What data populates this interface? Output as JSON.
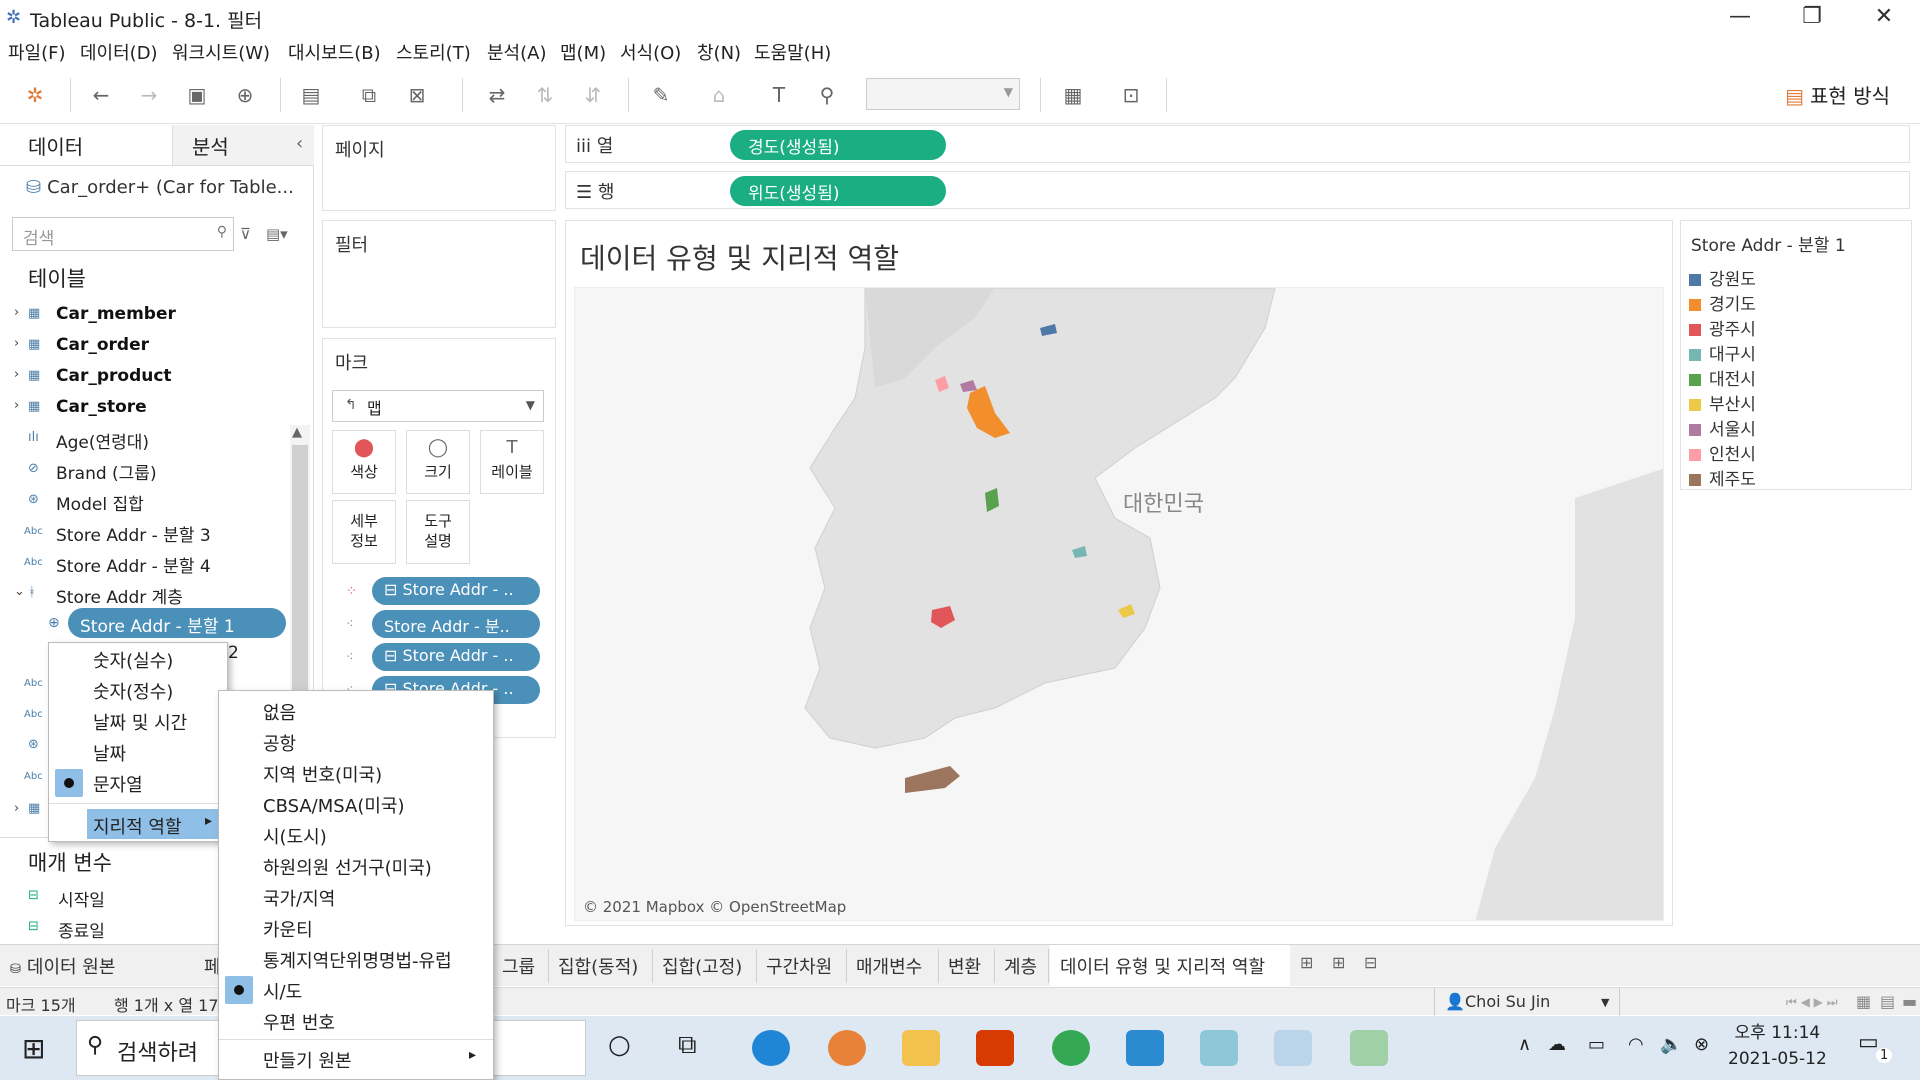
{
  "window": {
    "title": "Tableau Public - 8-1. 필터",
    "minimize": "—",
    "restore": "❐",
    "close": "✕"
  },
  "menubar": [
    "파일(F)",
    "데이터(D)",
    "워크시트(W)",
    "대시보드(B)",
    "스토리(T)",
    "분석(A)",
    "맵(M)",
    "서식(O)",
    "창(N)",
    "도움말(H)"
  ],
  "toolbar": {
    "show_me": "표현 방식"
  },
  "left_panel": {
    "tab_data": "데이터",
    "tab_analysis": "분석",
    "collapse": "‹",
    "datasource": "Car_order+ (Car for Table...",
    "search_placeholder": "검색",
    "tables_heading": "테이블",
    "fields": [
      {
        "label": "Car_member",
        "icon": "▦",
        "bold": true,
        "arrow": "›"
      },
      {
        "label": "Car_order",
        "icon": "▦",
        "bold": true,
        "arrow": "›"
      },
      {
        "label": "Car_product",
        "icon": "▦",
        "bold": true,
        "arrow": "›"
      },
      {
        "label": "Car_store",
        "icon": "▦",
        "bold": true,
        "arrow": "›"
      },
      {
        "label": "Age(연령대)",
        "icon": "ılı",
        "bold": false,
        "arrow": ""
      },
      {
        "label": "Brand (그룹)",
        "icon": "⊘",
        "bold": false,
        "arrow": ""
      },
      {
        "label": "Model 집합",
        "icon": "⊛",
        "bold": false,
        "arrow": ""
      },
      {
        "label": "Store Addr - 분할 3",
        "icon": "Abc",
        "bold": false,
        "arrow": ""
      },
      {
        "label": "Store Addr - 분할 4",
        "icon": "Abc",
        "bold": false,
        "arrow": ""
      },
      {
        "label": "Store Addr 계층",
        "icon": "ᚼ",
        "bold": false,
        "arrow": "⌄"
      }
    ],
    "selected_field": "Store Addr - 분할 1",
    "partial_digit": "2",
    "params_heading": "매개 변수",
    "params": [
      "시작일",
      "종료일"
    ]
  },
  "cards": {
    "pages": "페이지",
    "filters": "필터",
    "marks": "마크"
  },
  "marks": {
    "type": "맵",
    "buttons": [
      {
        "label": "색상",
        "icon": "⬤"
      },
      {
        "label": "크기",
        "icon": "◯"
      },
      {
        "label": "레이블",
        "icon": "T"
      },
      {
        "label": "세부\n정보",
        "icon": ""
      },
      {
        "label": "도구\n설명",
        "icon": ""
      }
    ],
    "pills": [
      "⊟ Store Addr - ..",
      "Store Addr - 분..",
      "⊟ Store Addr - ..",
      "⊟ Store Addr - .."
    ]
  },
  "shelves": {
    "columns_label": "iii  열",
    "columns_pill": "경도(생성됨)",
    "rows_label": "☰  행",
    "rows_pill": "위도(생성됨)"
  },
  "view": {
    "title": "데이터 유형 및 지리적 역할",
    "map_label": "대한민국",
    "credit": "© 2021 Mapbox © OpenStreetMap"
  },
  "legend": {
    "title": "Store Addr - 분할 1",
    "items": [
      {
        "label": "강원도",
        "color": "#4e79a7"
      },
      {
        "label": "경기도",
        "color": "#f28e2b"
      },
      {
        "label": "광주시",
        "color": "#e15759"
      },
      {
        "label": "대구시",
        "color": "#76b7b2"
      },
      {
        "label": "대전시",
        "color": "#59a14f"
      },
      {
        "label": "부산시",
        "color": "#edc948"
      },
      {
        "label": "서울시",
        "color": "#b07aa1"
      },
      {
        "label": "인천시",
        "color": "#ff9da7"
      },
      {
        "label": "제주도",
        "color": "#9c755f"
      }
    ]
  },
  "sheet_tabs": {
    "datasource_tab": "데이터 원본",
    "partial": "페",
    "tabs": [
      "그룹",
      "집합(동적)",
      "집합(고정)",
      "구간차원",
      "매개변수",
      "변환",
      "계층",
      "데이터 유형 및 지리적 역할"
    ]
  },
  "status": {
    "marks": "마크 15개",
    "dims": "행 1개 x 열 17",
    "user": "Choi Su Jin"
  },
  "context_menu_type": {
    "items": [
      "숫자(실수)",
      "숫자(정수)",
      "날짜 및 시간",
      "날짜",
      "문자열"
    ],
    "checked_index": 4,
    "geo_role": "지리적 역할"
  },
  "context_menu_geo": {
    "items": [
      "없음",
      "공항",
      "지역 번호(미국)",
      "CBSA/MSA(미국)",
      "시(도시)",
      "하원의원 선거구(미국)",
      "국가/지역",
      "카운티",
      "통계지역단위명명법-유럽",
      "시/도",
      "우편 번호"
    ],
    "checked_index": 9,
    "create_from": "만들기 원본"
  },
  "taskbar": {
    "search_text": "검색하려",
    "clock_time": "오후 11:14",
    "clock_date": "2021-05-12",
    "notification_count": "1"
  }
}
